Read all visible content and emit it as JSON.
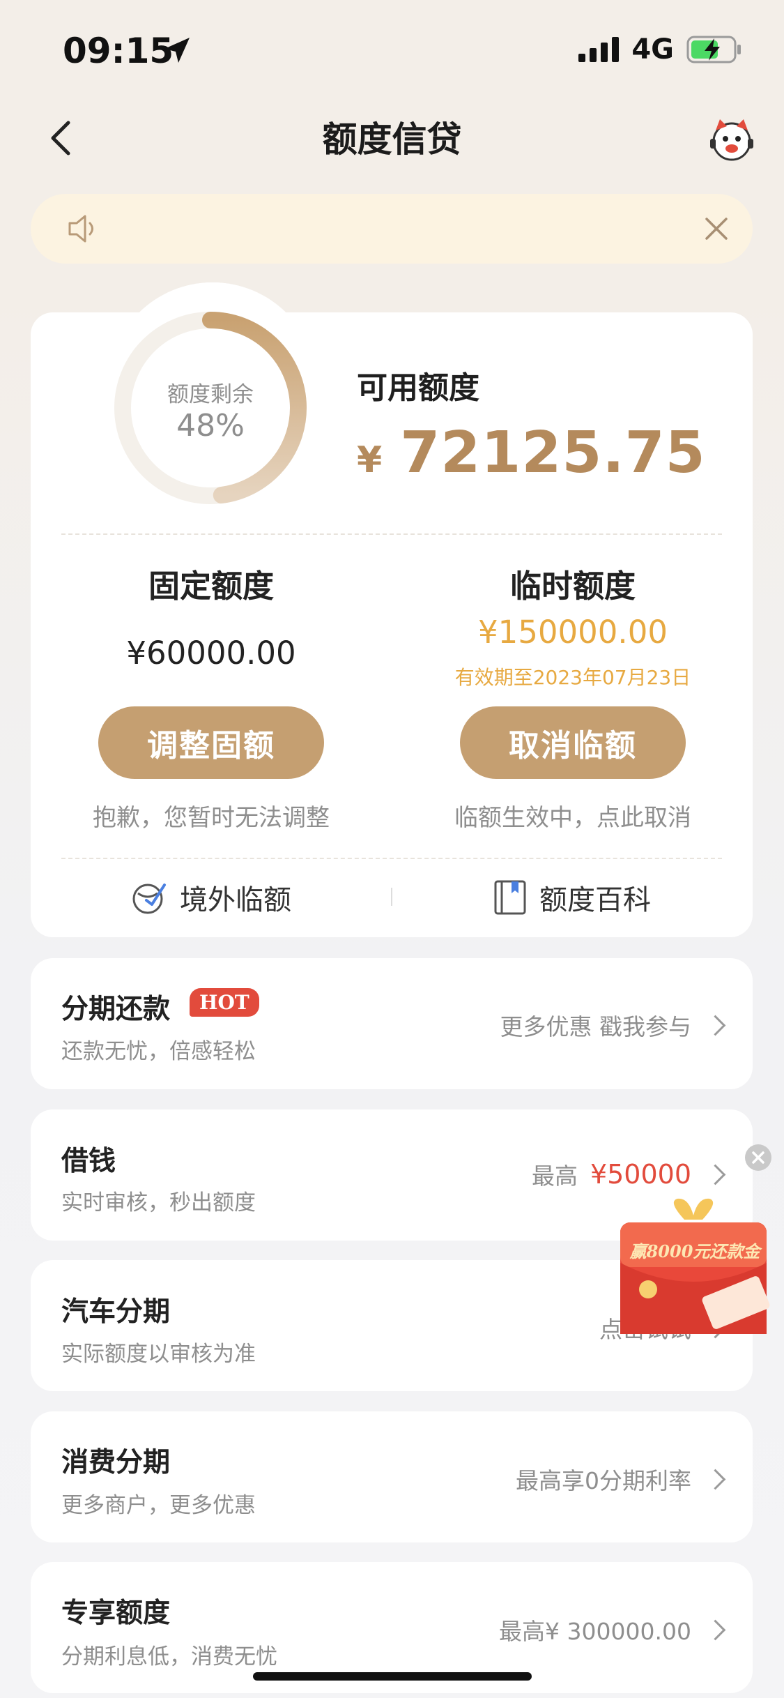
{
  "status": {
    "time": "09:15",
    "network": "4G"
  },
  "nav": {
    "title": "额度信贷"
  },
  "notice": {
    "text": ""
  },
  "credit": {
    "ring_label": "额度剩余",
    "ring_percent": "48%",
    "ring_fraction": 0.48,
    "available_title": "可用额度",
    "currency": "¥",
    "available_amount": "72125.75",
    "fixed_title": "固定额度",
    "fixed_amount": "¥60000.00",
    "temp_title": "临时额度",
    "temp_amount": "¥150000.00",
    "temp_valid": "有效期至2023年07月23日",
    "adjust_button": "调整固额",
    "cancel_button": "取消临额",
    "adjust_hint": "抱歉，您暂时无法调整",
    "cancel_hint": "临额生效中，点此取消",
    "overseas_link": "境外临额",
    "wiki_link": "额度百科"
  },
  "services": [
    {
      "title": "分期还款",
      "badge": "HOT",
      "subtitle": "还款无忧，倍感轻松",
      "right_text": "更多优惠 戳我参与"
    },
    {
      "title": "借钱",
      "subtitle": "实时审核，秒出额度",
      "right_label": "最高",
      "right_amount": "¥50000"
    },
    {
      "title": "汽车分期",
      "subtitle": "实际额度以审核为准",
      "right_text": "点击试试"
    },
    {
      "title": "消费分期",
      "subtitle": "更多商户，更多优惠",
      "right_text": "最高享0分期利率"
    },
    {
      "title": "专享额度",
      "subtitle": "分期利息低，消费无忧",
      "right_text": "最高¥ 300000.00"
    }
  ],
  "promo": {
    "text": "赢8000元还款金"
  },
  "colors": {
    "gold": "#c59f71",
    "amount_gold": "#b48a5c",
    "orange": "#e7a941",
    "red": "#e24b3c"
  }
}
